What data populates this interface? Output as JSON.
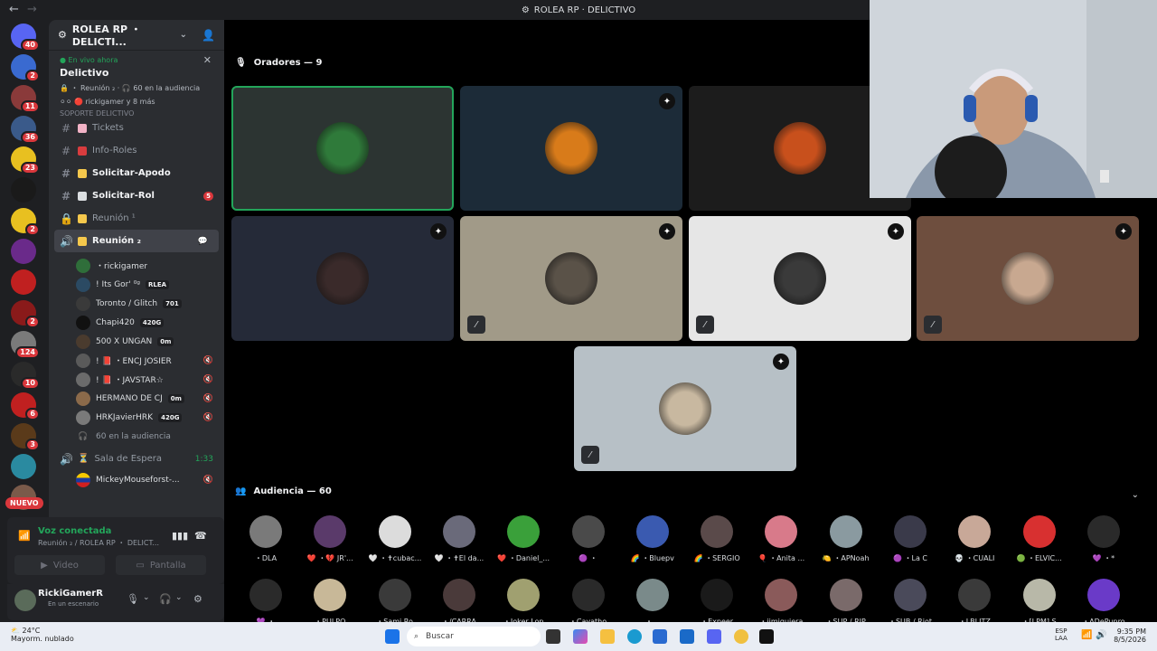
{
  "window": {
    "title": "ROLEA RP · DELICTIVO"
  },
  "server": {
    "name": "ROLEA RP ・ DELICTI..."
  },
  "live": {
    "status": "En vivo ahora",
    "channel": "Delictivo",
    "meta": "🔒 ・ Reunión ₂ · 🎧 60 en la audiencia",
    "participants": "rickigamer y 8 más",
    "close": "✕"
  },
  "category_fragment": "SOPORTE DELICTIVO",
  "channels": [
    {
      "icon": "#",
      "label": "Tickets",
      "emoji_color": "#f2b3c6",
      "bold": false
    },
    {
      "icon": "#",
      "label": "Info-Roles",
      "emoji_color": "#d83c3e",
      "bold": false
    },
    {
      "icon": "#",
      "label": "Solicitar-Apodo",
      "emoji_color": "#f5c84c",
      "bold": true
    },
    {
      "icon": "#",
      "label": "Solicitar-Rol",
      "emoji_color": "#dbdee1",
      "bold": true,
      "count": "5"
    },
    {
      "icon": "🔒",
      "label": "Reunión ¹",
      "emoji_color": "#f5c84c",
      "bold": false
    },
    {
      "icon": "🔊",
      "label": "Reunión ₂",
      "emoji_color": "#f5c84c",
      "bold": true,
      "active": true,
      "sub": "Delictivo"
    }
  ],
  "voice_users": [
    {
      "name": "・rickigamer",
      "tag": "",
      "color": "#2f6e3a"
    },
    {
      "name": "! Its Gor' ⁰ᵍ",
      "tag": "RLEA",
      "color": "#2b4a63"
    },
    {
      "name": "Toronto / Glitch",
      "tag": "701",
      "color": "#3a3a3a"
    },
    {
      "name": "Chapi420",
      "tag": "420G",
      "color": "#111111"
    },
    {
      "name": "500 X UNGAN",
      "tag": "0m",
      "color": "#4a3b2e"
    },
    {
      "name": "! 📕 ・ENCJ JOSIER",
      "tag": "",
      "color": "#5a5a5a",
      "muted": true
    },
    {
      "name": "! 📕 ・JAVSTAR☆",
      "tag": "",
      "color": "#6b6b6b",
      "muted": true
    },
    {
      "name": "HERMANO DE CJ",
      "tag": "0m",
      "color": "#8b6a4a",
      "muted": true
    },
    {
      "name": "HRKJavierHRK",
      "tag": "420G",
      "color": "#7a7a7a",
      "muted": true
    }
  ],
  "audience_link": "60 en la audiencia",
  "waiting": {
    "label": "Sala de Espera",
    "time": "1:33",
    "user": "MickeyMouseforst-..."
  },
  "voice_panel": {
    "title": "Voz conectada",
    "sub": "Reunión ₂ / ROLEA RP ・ DELICT...",
    "video": "Video",
    "screen": "Pantalla"
  },
  "user_panel": {
    "name": "RickiGamerR",
    "status": "En un escenario"
  },
  "stage": {
    "speakers_header": "Oradores — 9",
    "audience_header": "Audiencia — 60"
  },
  "speaker_tiles": [
    {
      "bg": "#2c3432",
      "pic": "#2f7a3a",
      "selected": true,
      "mod": false,
      "mic": false
    },
    {
      "bg": "#1c2b38",
      "pic": "#d87b1a",
      "selected": false,
      "mod": true,
      "mic": false
    },
    {
      "bg": "#1c1c1c",
      "pic": "#c8501c",
      "selected": false,
      "mod": false,
      "mic": false
    },
    {
      "bg": "#252a38",
      "pic": "#3a2a2a",
      "selected": false,
      "mod": true,
      "mic": false
    },
    {
      "bg": "#a19a88",
      "pic": "#5a5248",
      "selected": false,
      "mod": true,
      "mic": true
    },
    {
      "bg": "#e6e6e6",
      "pic": "#3a3a3a",
      "selected": false,
      "mod": true,
      "mic": true
    },
    {
      "bg": "#6e4e3e",
      "pic": "#c8a890",
      "selected": false,
      "mod": true,
      "mic": true
    },
    {
      "bg": "#b7c0c6",
      "pic": "#c8b8a0",
      "selected": false,
      "mod": true,
      "mic": true
    }
  ],
  "audience_row1": [
    {
      "name": "・DLA",
      "color": "#7a7a7a"
    },
    {
      "name": "❤️ ・💔 JR'...",
      "color": "#5a3a6a"
    },
    {
      "name": "🤍 ・✝cubac...",
      "color": "#dcdcdc"
    },
    {
      "name": "🤍 ・✝El da...",
      "color": "#6a6a7a"
    },
    {
      "name": "❤️ ・Daniel_...",
      "color": "#3aa03a"
    },
    {
      "name": "🟣 ・",
      "color": "#4a4a4a"
    },
    {
      "name": "🌈 ・Bluepv",
      "color": "#3a5ab0"
    },
    {
      "name": "🌈 ・SERGIO",
      "color": "#5a4a4a"
    },
    {
      "name": "🎈 ・Anita ...",
      "color": "#d87a8a"
    },
    {
      "name": "🍋 ・APNoah",
      "color": "#8a9aa0"
    },
    {
      "name": "🟣 ・La C",
      "color": "#3a3a4a"
    },
    {
      "name": "💀 ・CUALI",
      "color": "#c8a898"
    },
    {
      "name": "🟢 ・ELVIC...",
      "color": "#d83030"
    },
    {
      "name": "💜 ・*",
      "color": "#2a2a2a"
    }
  ],
  "audience_row2": [
    {
      "name": "💜 ・",
      "color": "#2a2a2a"
    },
    {
      "name": "・PULPO",
      "color": "#c8b898"
    },
    {
      "name": "・Sami Ro",
      "color": "#3a3a3a"
    },
    {
      "name": "・/CARRA",
      "color": "#4a3a3a"
    },
    {
      "name": "・Joker Lop",
      "color": "#a0a070"
    },
    {
      "name": "・Cavatho",
      "color": "#2a2a2a"
    },
    {
      "name": "・...",
      "color": "#7a8a8a"
    },
    {
      "name": "・Expeer",
      "color": "#1a1a1a"
    },
    {
      "name": "・jimiquiera",
      "color": "#8a5a5a"
    },
    {
      "name": "・SUP / RIP",
      "color": "#7a6a6a"
    },
    {
      "name": "・SUB / Riot",
      "color": "#4a4a5a"
    },
    {
      "name": "・LBLITZ",
      "color": "#3a3a3a"
    },
    {
      "name": "・[LPM] S",
      "color": "#b8b8a8"
    },
    {
      "name": "・ADePunro",
      "color": "#6a3ac8"
    }
  ],
  "servers": [
    {
      "color": "#5865f2",
      "badge": "40"
    },
    {
      "color": "#3a6ad0",
      "badge": "2"
    },
    {
      "color": "#8a3a3a",
      "badge": "11"
    },
    {
      "color": "#3a5a8a",
      "badge": "36"
    },
    {
      "color": "#e8c020",
      "badge": "23"
    },
    {
      "color": "#1a1a1a",
      "badge": ""
    },
    {
      "color": "#e8c020",
      "badge": "2"
    },
    {
      "color": "#6a2a8a",
      "badge": ""
    },
    {
      "color": "#c02020",
      "badge": ""
    },
    {
      "color": "#8a1a1a",
      "badge": "2"
    },
    {
      "color": "#7a7a7a",
      "badge": "124"
    },
    {
      "color": "#2a2a2a",
      "badge": "10"
    },
    {
      "color": "#c02020",
      "badge": "6"
    },
    {
      "color": "#5a3a1a",
      "badge": "3"
    },
    {
      "color": "#2a8aa0",
      "badge": ""
    },
    {
      "color": "#7a5a4a",
      "badge": ""
    }
  ],
  "new_label": "NUEVO",
  "taskbar": {
    "temp": "24°C",
    "weather": "Mayorm. nublado",
    "search": "Buscar",
    "lang1": "ESP",
    "lang2": "LAA",
    "time": "9:35 PM",
    "date": "8/5/2026"
  }
}
